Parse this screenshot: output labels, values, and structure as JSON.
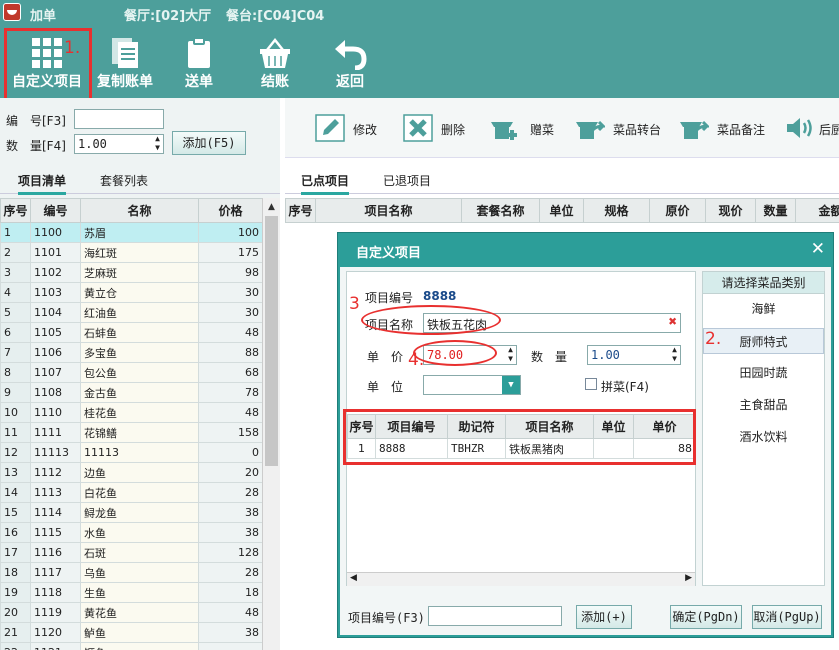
{
  "titlebar": {
    "title": "加单",
    "restaurant": "餐厅:[02]大厅",
    "table": "餐台:[C04]C04"
  },
  "toolbar": {
    "custom_item": "自定义项目",
    "copy_bill": "复制账单",
    "send_order": "送单",
    "checkout": "结账",
    "back": "返回"
  },
  "annotations": {
    "one": "1.",
    "two": "2.",
    "three": "3",
    "four": "4."
  },
  "left": {
    "code_label": "编　号[F3]",
    "code_value": "",
    "qty_label": "数　量[F4]",
    "qty_value": "1.00",
    "add_button": "添加(F5)",
    "tab_items": "项目清单",
    "tab_packages": "套餐列表",
    "columns": {
      "no": "序号",
      "code": "编号",
      "name": "名称",
      "price": "价格"
    },
    "rows": [
      {
        "no": "1",
        "code": "1100",
        "name": "苏眉",
        "price": "100"
      },
      {
        "no": "2",
        "code": "1101",
        "name": "海红斑",
        "price": "175"
      },
      {
        "no": "3",
        "code": "1102",
        "name": "芝麻斑",
        "price": "98"
      },
      {
        "no": "4",
        "code": "1103",
        "name": "黄立仓",
        "price": "30"
      },
      {
        "no": "5",
        "code": "1104",
        "name": "红油鱼",
        "price": "30"
      },
      {
        "no": "6",
        "code": "1105",
        "name": "石蚌鱼",
        "price": "48"
      },
      {
        "no": "7",
        "code": "1106",
        "name": "多宝鱼",
        "price": "88"
      },
      {
        "no": "8",
        "code": "1107",
        "name": "包公鱼",
        "price": "68"
      },
      {
        "no": "9",
        "code": "1108",
        "name": "金古鱼",
        "price": "78"
      },
      {
        "no": "10",
        "code": "1110",
        "name": "桂花鱼",
        "price": "48"
      },
      {
        "no": "11",
        "code": "1111",
        "name": "花锦鳝",
        "price": "158"
      },
      {
        "no": "12",
        "code": "11113",
        "name": "11113",
        "price": "0"
      },
      {
        "no": "13",
        "code": "1112",
        "name": "边鱼",
        "price": "20"
      },
      {
        "no": "14",
        "code": "1113",
        "name": "白花鱼",
        "price": "28"
      },
      {
        "no": "15",
        "code": "1114",
        "name": "鲟龙鱼",
        "price": "38"
      },
      {
        "no": "16",
        "code": "1115",
        "name": "水鱼",
        "price": "38"
      },
      {
        "no": "17",
        "code": "1116",
        "name": "石斑",
        "price": "128"
      },
      {
        "no": "18",
        "code": "1117",
        "name": "乌鱼",
        "price": "28"
      },
      {
        "no": "19",
        "code": "1118",
        "name": "生鱼",
        "price": "18"
      },
      {
        "no": "20",
        "code": "1119",
        "name": "黄花鱼",
        "price": "48"
      },
      {
        "no": "21",
        "code": "1120",
        "name": "鲈鱼",
        "price": "38"
      },
      {
        "no": "22",
        "code": "1121",
        "name": "鳜鱼",
        "price": ""
      }
    ]
  },
  "right": {
    "actions": {
      "edit": "修改",
      "delete": "删除",
      "gift": "赠菜",
      "transfer": "菜品转台",
      "note": "菜品备注",
      "broadcast": "后厨"
    },
    "tab_ordered": "已点项目",
    "tab_returned": "已退项目",
    "columns": [
      "序号",
      "项目名称",
      "套餐名称",
      "单位",
      "规格",
      "原价",
      "现价",
      "数量",
      "金额"
    ]
  },
  "dialog": {
    "title": "自定义项目",
    "close": "✕",
    "code_label": "项目编号",
    "code_value": "8888",
    "name_label": "项目名称",
    "name_value": "铁板五花肉",
    "price_label": "单　价",
    "price_value": "78.00",
    "qty_label": "数　量",
    "qty_value": "1.00",
    "unit_label": "单　位",
    "unit_value": "",
    "combo_label": "拼菜(F4)",
    "grid_columns": {
      "no": "序号",
      "code": "项目编号",
      "mnemonic": "助记符",
      "name": "项目名称",
      "unit": "单位",
      "price": "单价"
    },
    "grid_rows": [
      {
        "no": "1",
        "code": "8888",
        "mnemonic": "TBHZR",
        "name": "铁板黑猪肉",
        "unit": "",
        "price": "88"
      }
    ],
    "category_header": "请选择菜品类别",
    "categories": [
      "海鲜",
      "厨师特式",
      "田园时蔬",
      "主食甜品",
      "酒水饮料"
    ],
    "bottom_code_label": "项目编号(F3)",
    "bottom_code_value": "",
    "add_button": "添加(+)",
    "ok_button": "确定(PgDn)",
    "cancel_button": "取消(PgUp)"
  }
}
